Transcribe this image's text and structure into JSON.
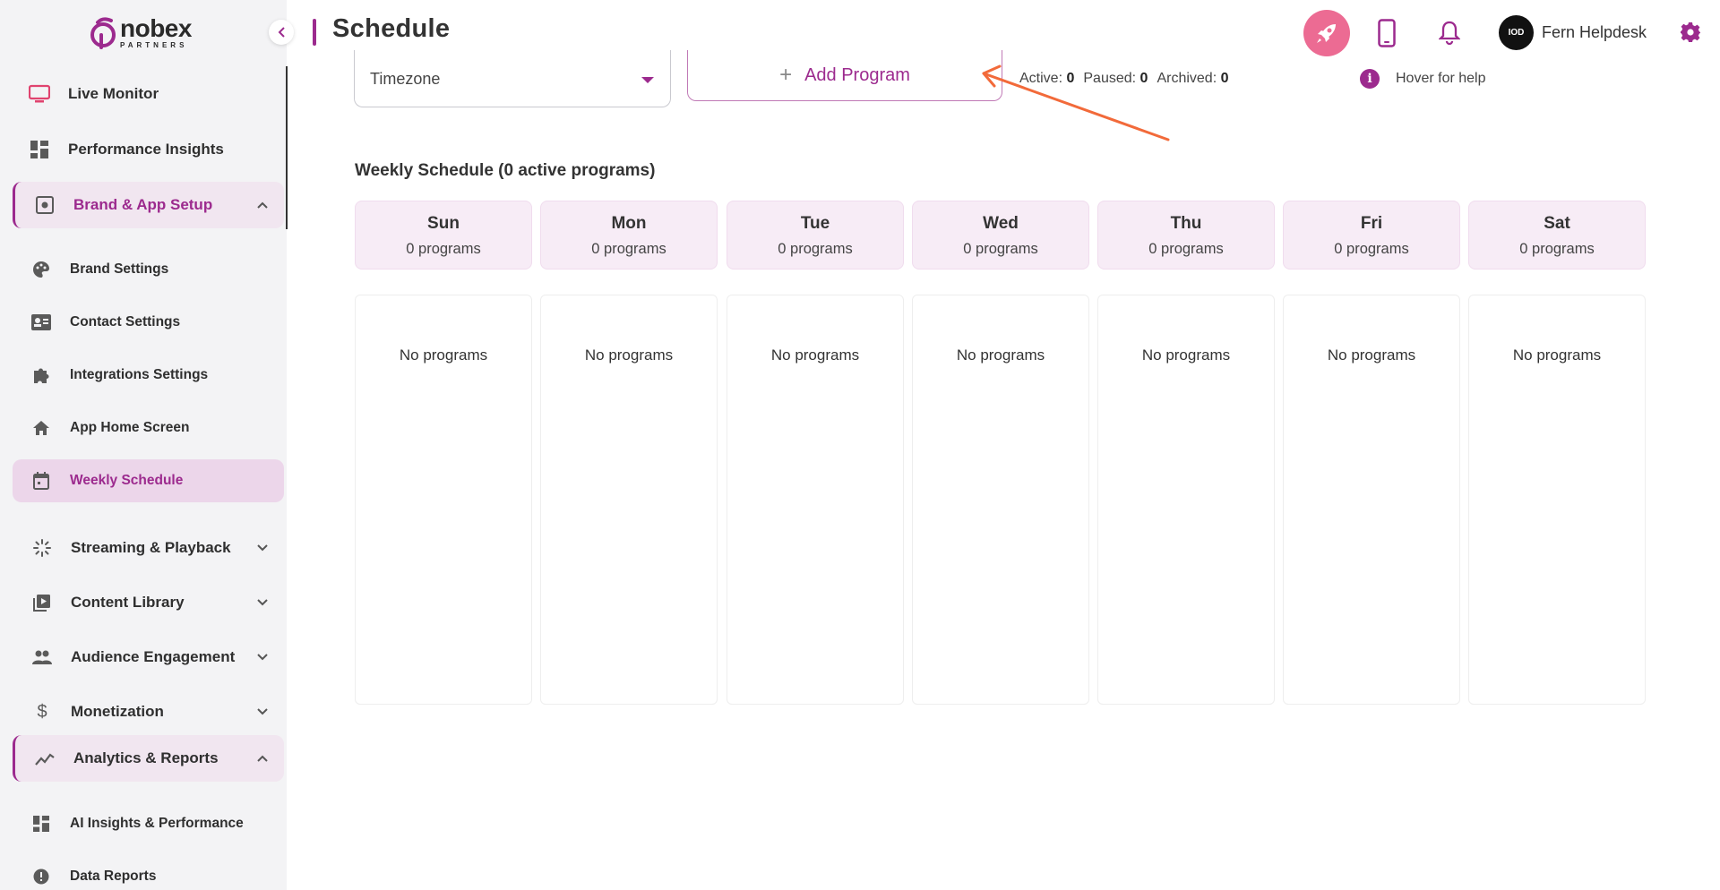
{
  "brand": {
    "name": "nobex",
    "subtitle": "PARTNERS"
  },
  "sidebar": {
    "top_items": [
      {
        "label": "Live Monitor",
        "icon": "monitor-icon"
      },
      {
        "label": "Performance Insights",
        "icon": "dashboard-icon"
      }
    ],
    "brand_section": {
      "label": "Brand & App Setup",
      "icon": "app-settings-icon",
      "items": [
        {
          "label": "Brand Settings",
          "icon": "palette-icon"
        },
        {
          "label": "Contact Settings",
          "icon": "contact-card-icon"
        },
        {
          "label": "Integrations Settings",
          "icon": "puzzle-icon"
        },
        {
          "label": "App Home Screen",
          "icon": "home-icon"
        },
        {
          "label": "Weekly Schedule",
          "icon": "calendar-icon",
          "active": true
        }
      ]
    },
    "sections": [
      {
        "label": "Streaming & Playback",
        "icon": "streaming-icon"
      },
      {
        "label": "Content Library",
        "icon": "library-icon"
      },
      {
        "label": "Audience Engagement",
        "icon": "people-icon"
      },
      {
        "label": "Monetization",
        "icon": "dollar-icon"
      }
    ],
    "analytics_section": {
      "label": "Analytics & Reports",
      "icon": "analytics-icon",
      "items": [
        {
          "label": "AI Insights & Performance",
          "icon": "dashboard-icon"
        },
        {
          "label": "Data Reports",
          "icon": "info-circle-icon"
        }
      ]
    }
  },
  "header": {
    "title": "Schedule",
    "user_name": "Fern Helpdesk",
    "avatar_text": "IOD"
  },
  "toolbar": {
    "timezone_label": "Timezone",
    "add_program_label": "Add Program",
    "active_label": "Active:",
    "active_count": "0",
    "paused_label": "Paused:",
    "paused_count": "0",
    "archived_label": "Archived:",
    "archived_count": "0",
    "help_text": "Hover for help"
  },
  "schedule": {
    "title": "Weekly Schedule (0 active programs)",
    "empty_text": "No programs",
    "days": [
      {
        "name": "Sun",
        "count": "0 programs"
      },
      {
        "name": "Mon",
        "count": "0 programs"
      },
      {
        "name": "Tue",
        "count": "0 programs"
      },
      {
        "name": "Wed",
        "count": "0 programs"
      },
      {
        "name": "Thu",
        "count": "0 programs"
      },
      {
        "name": "Fri",
        "count": "0 programs"
      },
      {
        "name": "Sat",
        "count": "0 programs"
      }
    ]
  },
  "colors": {
    "accent": "#9c2a8e",
    "active_bg": "#ecd6ea",
    "rocket_bg": "#ec6b93",
    "arrow": "#f26a3a"
  }
}
